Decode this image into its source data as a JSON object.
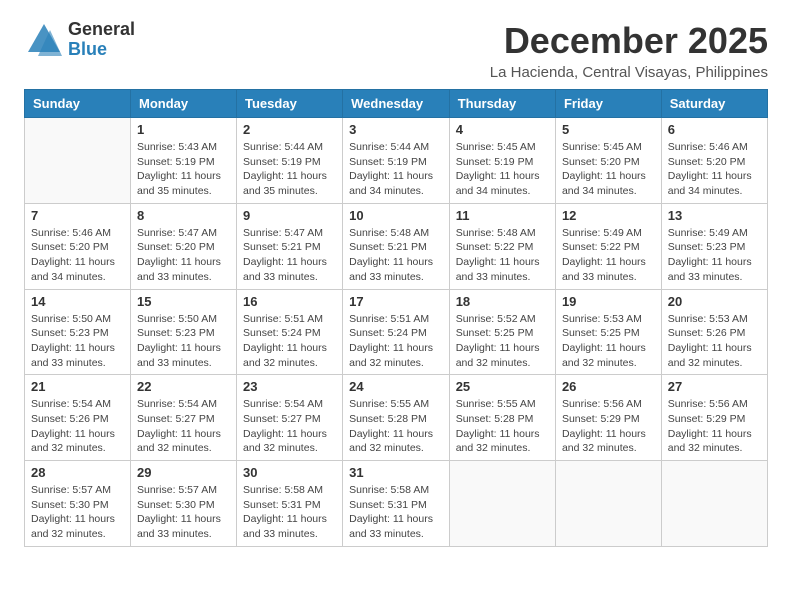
{
  "logo": {
    "line1": "General",
    "line2": "Blue"
  },
  "title": "December 2025",
  "subtitle": "La Hacienda, Central Visayas, Philippines",
  "days_of_week": [
    "Sunday",
    "Monday",
    "Tuesday",
    "Wednesday",
    "Thursday",
    "Friday",
    "Saturday"
  ],
  "weeks": [
    [
      {
        "day": "",
        "info": ""
      },
      {
        "day": "1",
        "info": "Sunrise: 5:43 AM\nSunset: 5:19 PM\nDaylight: 11 hours\nand 35 minutes."
      },
      {
        "day": "2",
        "info": "Sunrise: 5:44 AM\nSunset: 5:19 PM\nDaylight: 11 hours\nand 35 minutes."
      },
      {
        "day": "3",
        "info": "Sunrise: 5:44 AM\nSunset: 5:19 PM\nDaylight: 11 hours\nand 34 minutes."
      },
      {
        "day": "4",
        "info": "Sunrise: 5:45 AM\nSunset: 5:19 PM\nDaylight: 11 hours\nand 34 minutes."
      },
      {
        "day": "5",
        "info": "Sunrise: 5:45 AM\nSunset: 5:20 PM\nDaylight: 11 hours\nand 34 minutes."
      },
      {
        "day": "6",
        "info": "Sunrise: 5:46 AM\nSunset: 5:20 PM\nDaylight: 11 hours\nand 34 minutes."
      }
    ],
    [
      {
        "day": "7",
        "info": "Sunrise: 5:46 AM\nSunset: 5:20 PM\nDaylight: 11 hours\nand 34 minutes."
      },
      {
        "day": "8",
        "info": "Sunrise: 5:47 AM\nSunset: 5:20 PM\nDaylight: 11 hours\nand 33 minutes."
      },
      {
        "day": "9",
        "info": "Sunrise: 5:47 AM\nSunset: 5:21 PM\nDaylight: 11 hours\nand 33 minutes."
      },
      {
        "day": "10",
        "info": "Sunrise: 5:48 AM\nSunset: 5:21 PM\nDaylight: 11 hours\nand 33 minutes."
      },
      {
        "day": "11",
        "info": "Sunrise: 5:48 AM\nSunset: 5:22 PM\nDaylight: 11 hours\nand 33 minutes."
      },
      {
        "day": "12",
        "info": "Sunrise: 5:49 AM\nSunset: 5:22 PM\nDaylight: 11 hours\nand 33 minutes."
      },
      {
        "day": "13",
        "info": "Sunrise: 5:49 AM\nSunset: 5:23 PM\nDaylight: 11 hours\nand 33 minutes."
      }
    ],
    [
      {
        "day": "14",
        "info": "Sunrise: 5:50 AM\nSunset: 5:23 PM\nDaylight: 11 hours\nand 33 minutes."
      },
      {
        "day": "15",
        "info": "Sunrise: 5:50 AM\nSunset: 5:23 PM\nDaylight: 11 hours\nand 33 minutes."
      },
      {
        "day": "16",
        "info": "Sunrise: 5:51 AM\nSunset: 5:24 PM\nDaylight: 11 hours\nand 32 minutes."
      },
      {
        "day": "17",
        "info": "Sunrise: 5:51 AM\nSunset: 5:24 PM\nDaylight: 11 hours\nand 32 minutes."
      },
      {
        "day": "18",
        "info": "Sunrise: 5:52 AM\nSunset: 5:25 PM\nDaylight: 11 hours\nand 32 minutes."
      },
      {
        "day": "19",
        "info": "Sunrise: 5:53 AM\nSunset: 5:25 PM\nDaylight: 11 hours\nand 32 minutes."
      },
      {
        "day": "20",
        "info": "Sunrise: 5:53 AM\nSunset: 5:26 PM\nDaylight: 11 hours\nand 32 minutes."
      }
    ],
    [
      {
        "day": "21",
        "info": "Sunrise: 5:54 AM\nSunset: 5:26 PM\nDaylight: 11 hours\nand 32 minutes."
      },
      {
        "day": "22",
        "info": "Sunrise: 5:54 AM\nSunset: 5:27 PM\nDaylight: 11 hours\nand 32 minutes."
      },
      {
        "day": "23",
        "info": "Sunrise: 5:54 AM\nSunset: 5:27 PM\nDaylight: 11 hours\nand 32 minutes."
      },
      {
        "day": "24",
        "info": "Sunrise: 5:55 AM\nSunset: 5:28 PM\nDaylight: 11 hours\nand 32 minutes."
      },
      {
        "day": "25",
        "info": "Sunrise: 5:55 AM\nSunset: 5:28 PM\nDaylight: 11 hours\nand 32 minutes."
      },
      {
        "day": "26",
        "info": "Sunrise: 5:56 AM\nSunset: 5:29 PM\nDaylight: 11 hours\nand 32 minutes."
      },
      {
        "day": "27",
        "info": "Sunrise: 5:56 AM\nSunset: 5:29 PM\nDaylight: 11 hours\nand 32 minutes."
      }
    ],
    [
      {
        "day": "28",
        "info": "Sunrise: 5:57 AM\nSunset: 5:30 PM\nDaylight: 11 hours\nand 32 minutes."
      },
      {
        "day": "29",
        "info": "Sunrise: 5:57 AM\nSunset: 5:30 PM\nDaylight: 11 hours\nand 33 minutes."
      },
      {
        "day": "30",
        "info": "Sunrise: 5:58 AM\nSunset: 5:31 PM\nDaylight: 11 hours\nand 33 minutes."
      },
      {
        "day": "31",
        "info": "Sunrise: 5:58 AM\nSunset: 5:31 PM\nDaylight: 11 hours\nand 33 minutes."
      },
      {
        "day": "",
        "info": ""
      },
      {
        "day": "",
        "info": ""
      },
      {
        "day": "",
        "info": ""
      }
    ]
  ]
}
